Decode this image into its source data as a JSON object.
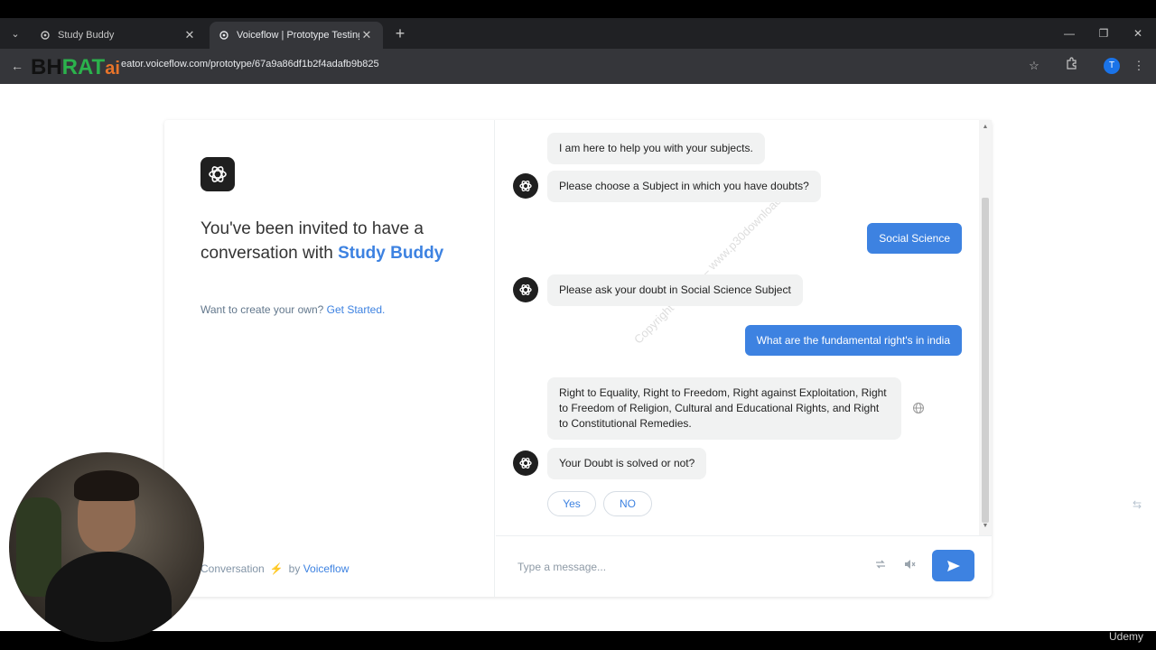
{
  "browser": {
    "tabs": [
      {
        "title": "Study Buddy",
        "active": false
      },
      {
        "title": "Voiceflow | Prototype Testing",
        "active": true
      }
    ],
    "url": "creator.voiceflow.com/prototype/67a9a86df1b2f4adafb9b825",
    "url_visible": "eator.voiceflow.com/prototype/67a9a86df1b2f4adafb9b825",
    "profile_initial": "T"
  },
  "overlay_logo": {
    "part1": "BH",
    "part2": "RAT",
    "part3": "ai"
  },
  "left_panel": {
    "invite_prefix": "You've been invited to have a conversation with",
    "bot_name": "Study Buddy",
    "create_text": "Want to create your own?",
    "create_link": "Get Started.",
    "footer_text": "Conversation",
    "footer_by": "by",
    "footer_brand": "Voiceflow"
  },
  "chat": {
    "messages": [
      {
        "from": "bot",
        "text": "I am here to help you with your subjects.",
        "avatar": false
      },
      {
        "from": "bot",
        "text": "Please choose a Subject in which you have doubts?",
        "avatar": true
      },
      {
        "from": "user",
        "text": "Social Science"
      },
      {
        "from": "bot",
        "text": "Please ask your doubt in Social Science Subject",
        "avatar": true
      },
      {
        "from": "user",
        "text": "What are the fundamental right's in india"
      },
      {
        "from": "bot",
        "text": "Right to Equality, Right to Freedom, Right against Exploitation, Right to Freedom of Religion, Cultural and Educational Rights, and Right to Constitutional Remedies.",
        "avatar": false
      },
      {
        "from": "bot",
        "text": "Your Doubt is solved or not?",
        "avatar": true
      }
    ],
    "choices": [
      "Yes",
      "NO"
    ],
    "watermark": "Copyright © 2025 – www.p30download.com"
  },
  "input": {
    "placeholder": "Type a message..."
  },
  "footer_brand": "Udemy",
  "colors": {
    "accent": "#3d82e1",
    "bot_bubble": "#f1f2f2",
    "chrome_dark": "#202124"
  }
}
